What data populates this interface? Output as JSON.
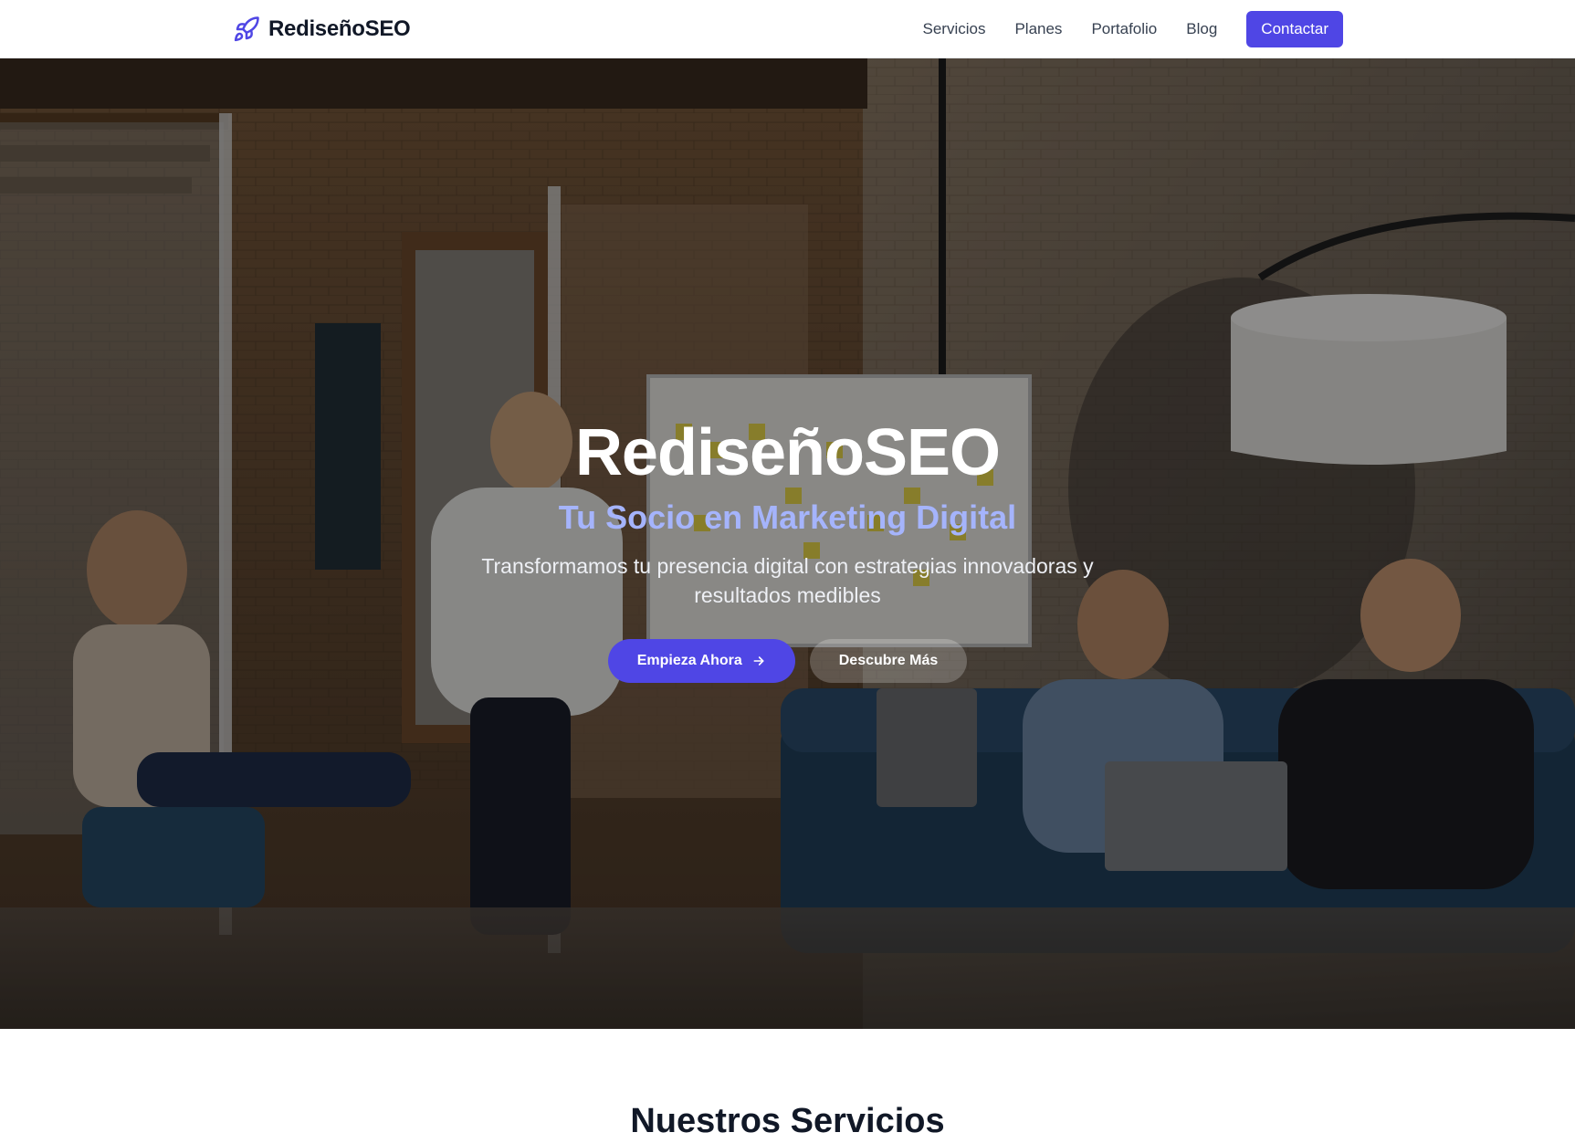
{
  "navbar": {
    "brand": "RediseñoSEO",
    "brand_icon": "rocket-icon",
    "links": [
      "Servicios",
      "Planes",
      "Portafolio",
      "Blog"
    ],
    "cta_label": "Contactar"
  },
  "hero": {
    "title": "RediseñoSEO",
    "subtitle": "Tu Socio en Marketing Digital",
    "description": "Transformamos tu presencia digital con estrategias innovadoras y resultados medibles",
    "primary_button": "Empieza Ahora",
    "primary_button_icon": "arrow-right-icon",
    "secondary_button": "Descubre Más"
  },
  "services": {
    "title": "Nuestros Servicios"
  },
  "colors": {
    "accent": "#4f46e5",
    "subtitle": "#a5b4fc",
    "text_dark": "#111827"
  }
}
